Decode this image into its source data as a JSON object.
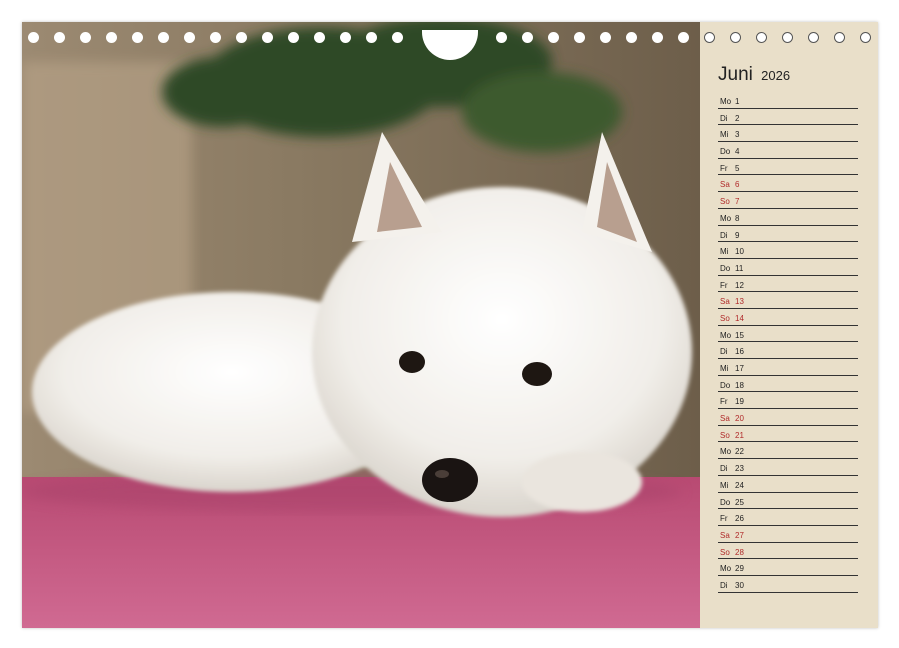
{
  "calendar": {
    "month": "Juni",
    "year": "2026",
    "days": [
      {
        "wd": "Mo",
        "d": "1",
        "weekend": false
      },
      {
        "wd": "Di",
        "d": "2",
        "weekend": false
      },
      {
        "wd": "Mi",
        "d": "3",
        "weekend": false
      },
      {
        "wd": "Do",
        "d": "4",
        "weekend": false
      },
      {
        "wd": "Fr",
        "d": "5",
        "weekend": false
      },
      {
        "wd": "Sa",
        "d": "6",
        "weekend": true
      },
      {
        "wd": "So",
        "d": "7",
        "weekend": true
      },
      {
        "wd": "Mo",
        "d": "8",
        "weekend": false
      },
      {
        "wd": "Di",
        "d": "9",
        "weekend": false
      },
      {
        "wd": "Mi",
        "d": "10",
        "weekend": false
      },
      {
        "wd": "Do",
        "d": "11",
        "weekend": false
      },
      {
        "wd": "Fr",
        "d": "12",
        "weekend": false
      },
      {
        "wd": "Sa",
        "d": "13",
        "weekend": true
      },
      {
        "wd": "So",
        "d": "14",
        "weekend": true
      },
      {
        "wd": "Mo",
        "d": "15",
        "weekend": false
      },
      {
        "wd": "Di",
        "d": "16",
        "weekend": false
      },
      {
        "wd": "Mi",
        "d": "17",
        "weekend": false
      },
      {
        "wd": "Do",
        "d": "18",
        "weekend": false
      },
      {
        "wd": "Fr",
        "d": "19",
        "weekend": false
      },
      {
        "wd": "Sa",
        "d": "20",
        "weekend": true
      },
      {
        "wd": "So",
        "d": "21",
        "weekend": true
      },
      {
        "wd": "Mo",
        "d": "22",
        "weekend": false
      },
      {
        "wd": "Di",
        "d": "23",
        "weekend": false
      },
      {
        "wd": "Mi",
        "d": "24",
        "weekend": false
      },
      {
        "wd": "Do",
        "d": "25",
        "weekend": false
      },
      {
        "wd": "Fr",
        "d": "26",
        "weekend": false
      },
      {
        "wd": "Sa",
        "d": "27",
        "weekend": true
      },
      {
        "wd": "So",
        "d": "28",
        "weekend": true
      },
      {
        "wd": "Mo",
        "d": "29",
        "weekend": false
      },
      {
        "wd": "Di",
        "d": "30",
        "weekend": false
      }
    ]
  },
  "photo": {
    "subject": "dog-photo",
    "colors": {
      "carpet": "#c8577f",
      "fur": "#f3f1ee",
      "background": "#7a6b55",
      "plant": "#2f4a26"
    }
  },
  "colors": {
    "panel": "#e9dfc9",
    "weekend": "#b02a2a",
    "text": "#222222"
  }
}
